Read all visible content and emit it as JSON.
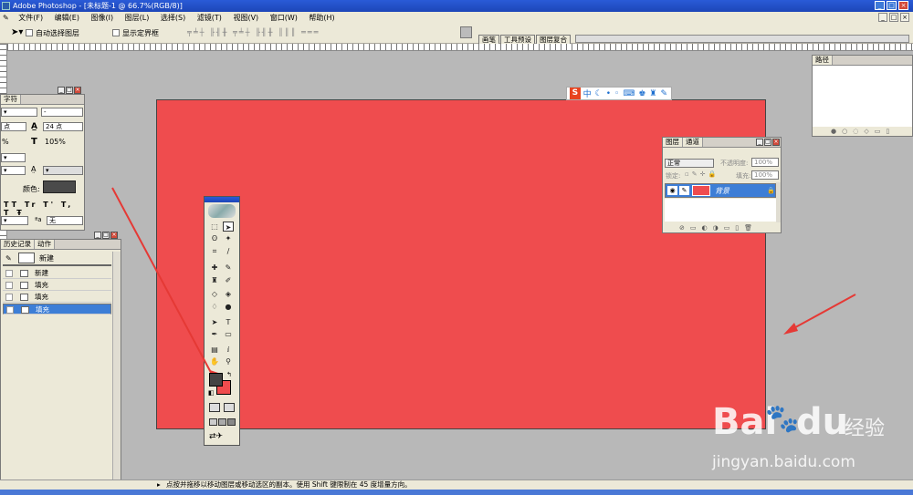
{
  "app": {
    "title": "Adobe Photoshop - [未标题-1 @ 66.7%(RGB/8)]",
    "window_buttons": [
      "_",
      "□",
      "×"
    ]
  },
  "menu": {
    "items": [
      "文件(F)",
      "编辑(E)",
      "图像(I)",
      "图层(L)",
      "选择(S)",
      "滤镜(T)",
      "视图(V)",
      "窗口(W)",
      "帮助(H)"
    ],
    "doc_buttons": [
      "_",
      "□",
      "×"
    ]
  },
  "options": {
    "auto_select_label": "自动选择图层",
    "show_bounds_label": "显示定界框",
    "palette_well_tabs": [
      "画笔",
      "工具预设",
      "图层复合"
    ]
  },
  "canvas": {
    "fill_color": "#ef4c4e"
  },
  "paths_panel": {
    "tab": "路径"
  },
  "character_panel": {
    "tab": "字符",
    "font_size": "24 点",
    "tracking_value": "点",
    "scale_left": "%",
    "vertical_scale": "105%",
    "color_label": "颜色:",
    "color_swatch": "#4a4a4a",
    "antialias_value": "无",
    "style_buttons": [
      "T",
      "T",
      "TT",
      "Tr",
      "T'",
      "T,",
      "T",
      "Ŧ"
    ]
  },
  "history_panel": {
    "tabs": [
      "历史记录",
      "动作"
    ],
    "snapshot_label": "新建",
    "rows": [
      {
        "label": "新建",
        "selected": false
      },
      {
        "label": "填充",
        "selected": false
      },
      {
        "label": "填充",
        "selected": false
      },
      {
        "label": "填充",
        "selected": true
      }
    ]
  },
  "layers_panel": {
    "tabs": [
      "图层",
      "通道"
    ],
    "blend_mode": "正常",
    "opacity_label": "不透明度:",
    "opacity_value": "100%",
    "lock_label": "锁定:",
    "fill_label": "填充:",
    "fill_value": "100%",
    "layer_name": "背景",
    "layer_color": "#ef4c4e"
  },
  "toolbox": {
    "foreground_color": "#444444",
    "background_color": "#ef4c4e"
  },
  "ime_toolbar": {
    "logo": "S",
    "mode": "中"
  },
  "status": {
    "text": "点按并拖移以移动图层或移动选区的副本。使用 Shift 键限制在 45 度增量方向。"
  },
  "watermark": {
    "brand": "Bai",
    "brand2": "du",
    "cn": "经验",
    "url": "jingyan.baidu.com"
  },
  "colors": {
    "title_bar": "#2a5bd7",
    "selection": "#3d7ed6",
    "arrow": "#e53935"
  }
}
